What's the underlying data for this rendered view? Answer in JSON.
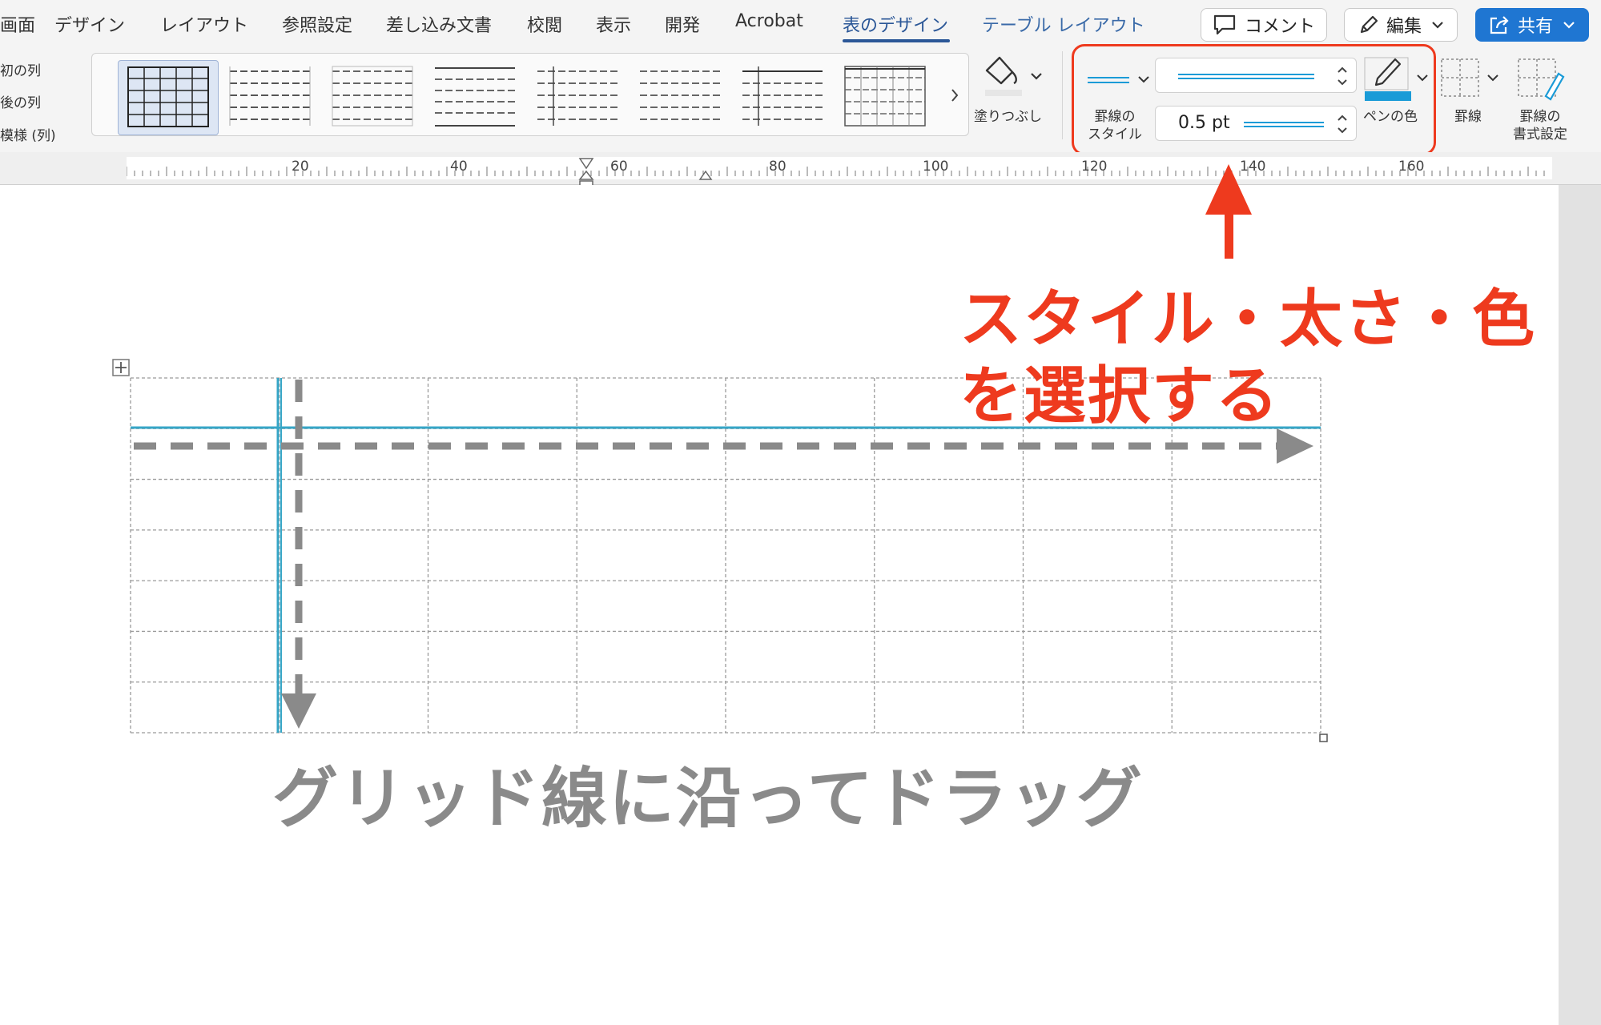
{
  "tabs": [
    {
      "label": "画面"
    },
    {
      "label": "デザイン"
    },
    {
      "label": "レイアウト"
    },
    {
      "label": "参照設定"
    },
    {
      "label": "差し込み文書"
    },
    {
      "label": "校閲"
    },
    {
      "label": "表示"
    },
    {
      "label": "開発"
    },
    {
      "label": "Acrobat"
    },
    {
      "label": "表のデザイン"
    },
    {
      "label": "テーブル レイアウト"
    }
  ],
  "header_buttons": {
    "comment": "コメント",
    "edit": "編集",
    "share": "共有"
  },
  "table_style_options": [
    "初の列",
    "後の列",
    "模様 (列)"
  ],
  "ribbon": {
    "shading_label": "塗りつぶし",
    "border_style_label_1": "罫線の",
    "border_style_label_2": "スタイル",
    "pen_weight_value": "0.5 pt",
    "pen_color_label": "ペンの色",
    "borders_label": "罫線",
    "border_painter_label_1": "罫線の",
    "border_painter_label_2": "書式設定",
    "pen_color": "#1a9bd7",
    "accent": "#2b5797"
  },
  "ruler": {
    "labels": [
      "20",
      "40",
      "60",
      "80",
      "100",
      "120",
      "140",
      "160"
    ]
  },
  "document": {
    "table": {
      "rows": 7,
      "cols": 8
    },
    "caption": "グリッド線に沿ってドラッグ"
  },
  "annotation": {
    "line1": "スタイル・太さ・色",
    "line2": "を選択する",
    "color": "#ee3a1e"
  }
}
